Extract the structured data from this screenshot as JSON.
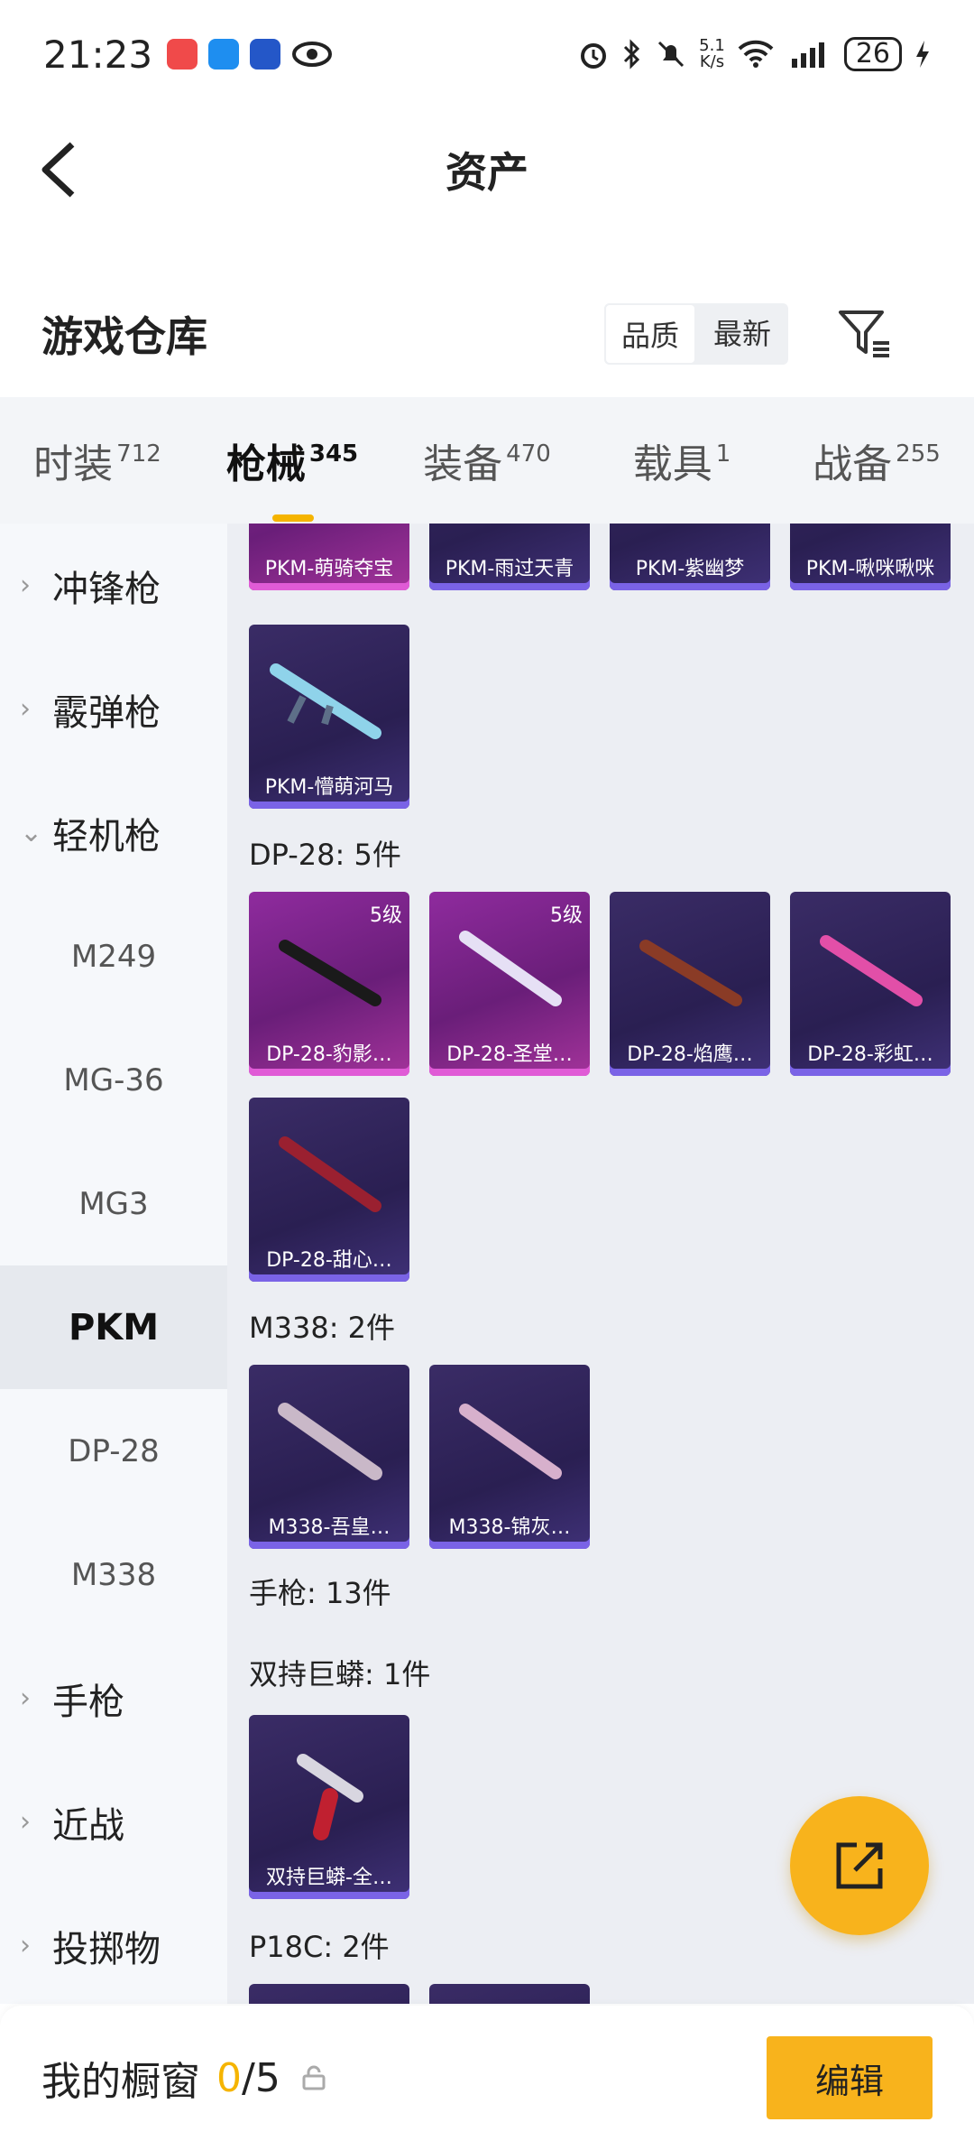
{
  "status": {
    "time": "21:23",
    "net_speed": "5.1\nK/s",
    "battery": "26"
  },
  "nav": {
    "title": "资产"
  },
  "warehouse": {
    "title": "游戏仓库",
    "sort_options": [
      "品质",
      "最新"
    ]
  },
  "tabs": [
    {
      "label": "时装",
      "count": "712"
    },
    {
      "label": "枪械",
      "count": "345"
    },
    {
      "label": "装备",
      "count": "470"
    },
    {
      "label": "载具",
      "count": "1"
    },
    {
      "label": "战备",
      "count": "255"
    }
  ],
  "sidebar": {
    "cats": [
      "冲锋枪",
      "霰弹枪",
      "轻机枪",
      "手枪",
      "近战",
      "投掷物"
    ],
    "subs": [
      "M249",
      "MG-36",
      "MG3",
      "PKM",
      "DP-28",
      "M338"
    ]
  },
  "groups": {
    "dp28": "DP-28: 5件",
    "m338": "M338: 2件",
    "pistol": "手枪: 13件",
    "python": "双持巨蟒: 1件",
    "p18c": "P18C: 2件"
  },
  "cards": {
    "pkm1": "PKM-萌骑夺宝",
    "pkm2": "PKM-雨过天青",
    "pkm3": "PKM-紫幽梦",
    "pkm4": "PKM-啾咪啾咪",
    "pkm5": "PKM-懵萌河马",
    "dp1": "DP-28-豹影…",
    "dp2": "DP-28-圣堂…",
    "dp3": "DP-28-焰鹰…",
    "dp4": "DP-28-彩虹…",
    "dp5": "DP-28-甜心…",
    "m1": "M338-吾皇…",
    "m2": "M338-锦灰…",
    "py1": "双持巨蟒-全…",
    "level": "5级"
  },
  "bottom": {
    "title": "我的橱窗",
    "current": "0",
    "total": "/5",
    "edit_label": "编辑"
  }
}
